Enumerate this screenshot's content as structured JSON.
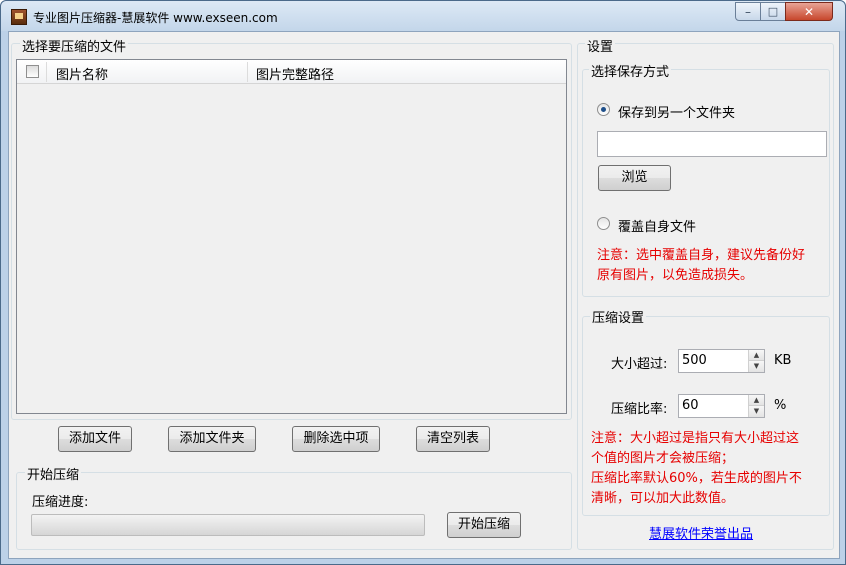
{
  "window": {
    "title": "专业图片压缩器-慧展软件 www.exseen.com",
    "controls": {
      "minimize": "–",
      "maximize": "□",
      "close": "✕"
    }
  },
  "files_panel": {
    "title": "选择要压缩的文件",
    "columns": [
      "图片名称",
      "图片完整路径"
    ],
    "rows": []
  },
  "file_buttons": {
    "add_file": "添加文件",
    "add_folder": "添加文件夹",
    "delete_selected": "删除选中项",
    "clear_list": "清空列表"
  },
  "compress_panel": {
    "title": "开始压缩",
    "progress_label": "压缩进度:",
    "progress": 0,
    "start_button": "开始压缩"
  },
  "settings": {
    "title": "设置",
    "save_mode": {
      "title": "选择保存方式",
      "option_other_folder": "保存到另一个文件夹",
      "option_other_folder_selected": true,
      "folder_path": "",
      "browse_button": "浏览",
      "option_overwrite": "覆盖自身文件",
      "option_overwrite_selected": false,
      "note_line1": "注意：选中覆盖自身，建议先备份好",
      "note_line2": "原有图片，以免造成损失。"
    },
    "compress_settings": {
      "title": "压缩设置",
      "size_label": "大小超过:",
      "size_value": "500",
      "size_unit": "KB",
      "ratio_label": "压缩比率:",
      "ratio_value": "60",
      "ratio_unit": "%",
      "note_line1": "注意：大小超过是指只有大小超过这",
      "note_line2": "个值的图片才会被压缩；",
      "note_line3": "压缩比率默认60%，若生成的图片不",
      "note_line4": "清晰，可以加大此数值。"
    },
    "credit_link": "慧展软件荣誉出品"
  },
  "colors": {
    "note_text": "#e60000",
    "link": "#0000ff"
  }
}
